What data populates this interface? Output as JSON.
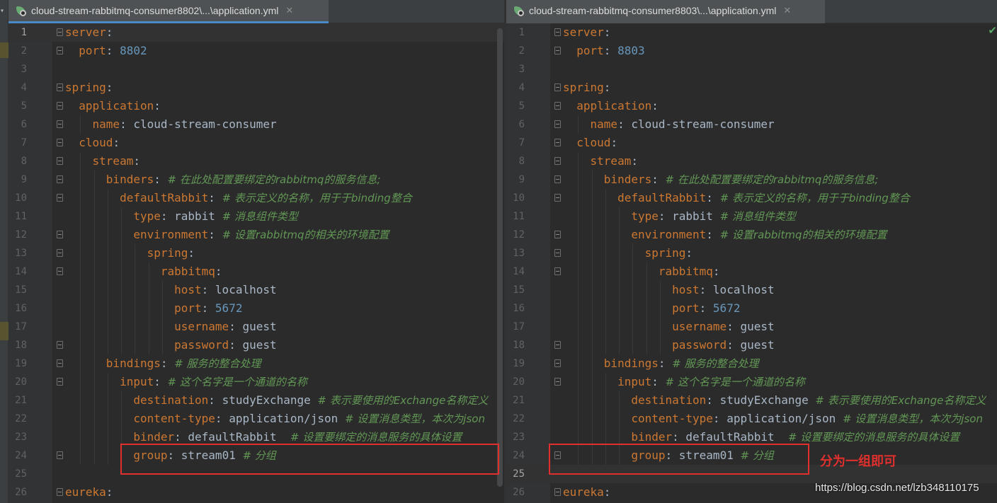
{
  "panes": [
    {
      "tab_title": "cloud-stream-rabbitmq-consumer8802\\...\\application.yml",
      "close_glyph": "✕",
      "current_line": 0,
      "lines": [
        [
          {
            "t": "key",
            "v": "server"
          },
          {
            "t": "val",
            "v": ":"
          }
        ],
        [
          {
            "t": "key",
            "v": "  port"
          },
          {
            "t": "val",
            "v": ": "
          },
          {
            "t": "num",
            "v": "8802"
          }
        ],
        [],
        [
          {
            "t": "key",
            "v": "spring"
          },
          {
            "t": "val",
            "v": ":"
          }
        ],
        [
          {
            "t": "key",
            "v": "  application"
          },
          {
            "t": "val",
            "v": ":"
          }
        ],
        [
          {
            "t": "key",
            "v": "    name"
          },
          {
            "t": "val",
            "v": ": cloud-stream-consumer"
          }
        ],
        [
          {
            "t": "key",
            "v": "  cloud"
          },
          {
            "t": "val",
            "v": ":"
          }
        ],
        [
          {
            "t": "key",
            "v": "    stream"
          },
          {
            "t": "val",
            "v": ":"
          }
        ],
        [
          {
            "t": "key",
            "v": "      binders"
          },
          {
            "t": "val",
            "v": ": "
          },
          {
            "t": "cmt",
            "v": "# 在此处配置要绑定的rabbitmq的服务信息;"
          }
        ],
        [
          {
            "t": "key",
            "v": "        defaultRabbit"
          },
          {
            "t": "val",
            "v": ": "
          },
          {
            "t": "cmt",
            "v": "# 表示定义的名称，用于于binding整合"
          }
        ],
        [
          {
            "t": "key",
            "v": "          type"
          },
          {
            "t": "val",
            "v": ": rabbit "
          },
          {
            "t": "cmt",
            "v": "# 消息组件类型"
          }
        ],
        [
          {
            "t": "key",
            "v": "          environment"
          },
          {
            "t": "val",
            "v": ": "
          },
          {
            "t": "cmt",
            "v": "# 设置rabbitmq的相关的环境配置"
          }
        ],
        [
          {
            "t": "key",
            "v": "            spring"
          },
          {
            "t": "val",
            "v": ":"
          }
        ],
        [
          {
            "t": "key",
            "v": "              rabbitmq"
          },
          {
            "t": "val",
            "v": ":"
          }
        ],
        [
          {
            "t": "key",
            "v": "                host"
          },
          {
            "t": "val",
            "v": ": localhost"
          }
        ],
        [
          {
            "t": "key",
            "v": "                port"
          },
          {
            "t": "val",
            "v": ": "
          },
          {
            "t": "num",
            "v": "5672"
          }
        ],
        [
          {
            "t": "key",
            "v": "                username"
          },
          {
            "t": "val",
            "v": ": guest"
          }
        ],
        [
          {
            "t": "key",
            "v": "                password"
          },
          {
            "t": "val",
            "v": ": guest"
          }
        ],
        [
          {
            "t": "key",
            "v": "      bindings"
          },
          {
            "t": "val",
            "v": ": "
          },
          {
            "t": "cmt",
            "v": "# 服务的整合处理"
          }
        ],
        [
          {
            "t": "key",
            "v": "        input"
          },
          {
            "t": "val",
            "v": ": "
          },
          {
            "t": "cmt",
            "v": "# 这个名字是一个通道的名称"
          }
        ],
        [
          {
            "t": "key",
            "v": "          destination"
          },
          {
            "t": "val",
            "v": ": studyExchange "
          },
          {
            "t": "cmt",
            "v": "# 表示要使用的Exchange名称定义"
          }
        ],
        [
          {
            "t": "key",
            "v": "          content-type"
          },
          {
            "t": "val",
            "v": ": application/json "
          },
          {
            "t": "cmt",
            "v": "# 设置消息类型，本次为json"
          }
        ],
        [
          {
            "t": "key",
            "v": "          binder"
          },
          {
            "t": "val",
            "v": ": defaultRabbit  "
          },
          {
            "t": "cmt",
            "v": "# 设置要绑定的消息服务的具体设置"
          }
        ],
        [
          {
            "t": "key",
            "v": "          group"
          },
          {
            "t": "val",
            "v": ": stream01 "
          },
          {
            "t": "cmt",
            "v": "# 分组"
          }
        ],
        [],
        [
          {
            "t": "key",
            "v": "eureka"
          },
          {
            "t": "val",
            "v": ":"
          }
        ]
      ]
    },
    {
      "tab_title": "cloud-stream-rabbitmq-consumer8803\\...\\application.yml",
      "close_glyph": "✕",
      "current_line": 24,
      "lines": [
        [
          {
            "t": "key",
            "v": "server"
          },
          {
            "t": "val",
            "v": ":"
          }
        ],
        [
          {
            "t": "key",
            "v": "  port"
          },
          {
            "t": "val",
            "v": ": "
          },
          {
            "t": "num",
            "v": "8803"
          }
        ],
        [],
        [
          {
            "t": "key",
            "v": "spring"
          },
          {
            "t": "val",
            "v": ":"
          }
        ],
        [
          {
            "t": "key",
            "v": "  application"
          },
          {
            "t": "val",
            "v": ":"
          }
        ],
        [
          {
            "t": "key",
            "v": "    name"
          },
          {
            "t": "val",
            "v": ": cloud-stream-consumer"
          }
        ],
        [
          {
            "t": "key",
            "v": "  cloud"
          },
          {
            "t": "val",
            "v": ":"
          }
        ],
        [
          {
            "t": "key",
            "v": "    stream"
          },
          {
            "t": "val",
            "v": ":"
          }
        ],
        [
          {
            "t": "key",
            "v": "      binders"
          },
          {
            "t": "val",
            "v": ": "
          },
          {
            "t": "cmt",
            "v": "# 在此处配置要绑定的rabbitmq的服务信息;"
          }
        ],
        [
          {
            "t": "key",
            "v": "        defaultRabbit"
          },
          {
            "t": "val",
            "v": ": "
          },
          {
            "t": "cmt",
            "v": "# 表示定义的名称，用于于binding整合"
          }
        ],
        [
          {
            "t": "key",
            "v": "          type"
          },
          {
            "t": "val",
            "v": ": rabbit "
          },
          {
            "t": "cmt",
            "v": "# 消息组件类型"
          }
        ],
        [
          {
            "t": "key",
            "v": "          environment"
          },
          {
            "t": "val",
            "v": ": "
          },
          {
            "t": "cmt",
            "v": "# 设置rabbitmq的相关的环境配置"
          }
        ],
        [
          {
            "t": "key",
            "v": "            spring"
          },
          {
            "t": "val",
            "v": ":"
          }
        ],
        [
          {
            "t": "key",
            "v": "              rabbitmq"
          },
          {
            "t": "val",
            "v": ":"
          }
        ],
        [
          {
            "t": "key",
            "v": "                host"
          },
          {
            "t": "val",
            "v": ": localhost"
          }
        ],
        [
          {
            "t": "key",
            "v": "                port"
          },
          {
            "t": "val",
            "v": ": "
          },
          {
            "t": "num",
            "v": "5672"
          }
        ],
        [
          {
            "t": "key",
            "v": "                username"
          },
          {
            "t": "val",
            "v": ": guest"
          }
        ],
        [
          {
            "t": "key",
            "v": "                password"
          },
          {
            "t": "val",
            "v": ": guest"
          }
        ],
        [
          {
            "t": "key",
            "v": "      bindings"
          },
          {
            "t": "val",
            "v": ": "
          },
          {
            "t": "cmt",
            "v": "# 服务的整合处理"
          }
        ],
        [
          {
            "t": "key",
            "v": "        input"
          },
          {
            "t": "val",
            "v": ": "
          },
          {
            "t": "cmt",
            "v": "# 这个名字是一个通道的名称"
          }
        ],
        [
          {
            "t": "key",
            "v": "          destination"
          },
          {
            "t": "val",
            "v": ": studyExchange "
          },
          {
            "t": "cmt",
            "v": "# 表示要使用的Exchange名称定义"
          }
        ],
        [
          {
            "t": "key",
            "v": "          content-type"
          },
          {
            "t": "val",
            "v": ": application/json "
          },
          {
            "t": "cmt",
            "v": "# 设置消息类型，本次为json"
          }
        ],
        [
          {
            "t": "key",
            "v": "          binder"
          },
          {
            "t": "val",
            "v": ": defaultRabbit  "
          },
          {
            "t": "cmt",
            "v": "# 设置要绑定的消息服务的具体设置"
          }
        ],
        [
          {
            "t": "key",
            "v": "          group"
          },
          {
            "t": "val",
            "v": ": stream01 "
          },
          {
            "t": "cmt",
            "v": "# 分组"
          }
        ],
        [],
        [
          {
            "t": "key",
            "v": "eureka"
          },
          {
            "t": "val",
            "v": ":"
          }
        ]
      ]
    }
  ],
  "annotation": "分为一组即可",
  "watermark": "https://blog.csdn.net/lzb348110175",
  "check_glyph": "✔",
  "colors": {
    "accent": "#4a88c7",
    "keyword": "#cc7832",
    "comment": "#629755",
    "number": "#6897bb",
    "highlight": "#e0302e"
  }
}
